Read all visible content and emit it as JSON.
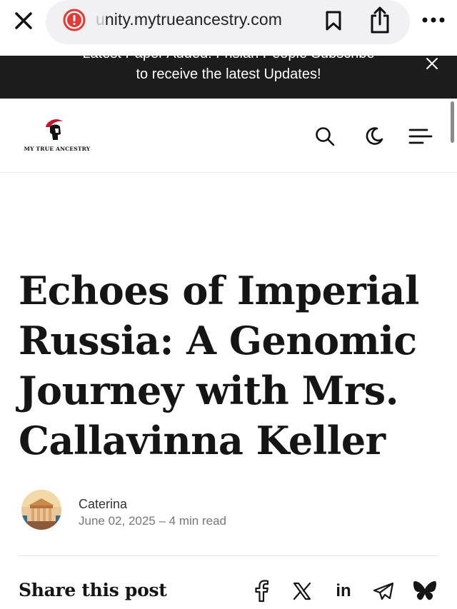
{
  "browser": {
    "url_prefix": "u",
    "url": "nity.mytrueancestry.com",
    "icons": [
      "close-icon",
      "warning-icon",
      "bookmark-icon",
      "share-icon",
      "more-icon"
    ]
  },
  "announcement": {
    "cut_text": "Latest Paper Added: Frisian People Subscribe",
    "text": "to receive the latest Updates!",
    "bg_color": "#1c1c1c"
  },
  "site": {
    "logo_text": "MY TRUE ANCESTRY",
    "brand_color": "#c8102e",
    "icons": [
      "search-icon",
      "moon-icon",
      "menu-icon"
    ]
  },
  "article": {
    "title": "Echoes of Imperial Russia: A Genomic Journey with Mrs. Callavinna Keller",
    "author": "Caterina",
    "meta": "June 02, 2025 – 4 min read"
  },
  "share": {
    "label": "Share this post",
    "linkedin_label": "in",
    "networks": [
      "facebook-icon",
      "x-icon",
      "linkedin-icon",
      "telegram-icon",
      "bluesky-icon"
    ]
  }
}
